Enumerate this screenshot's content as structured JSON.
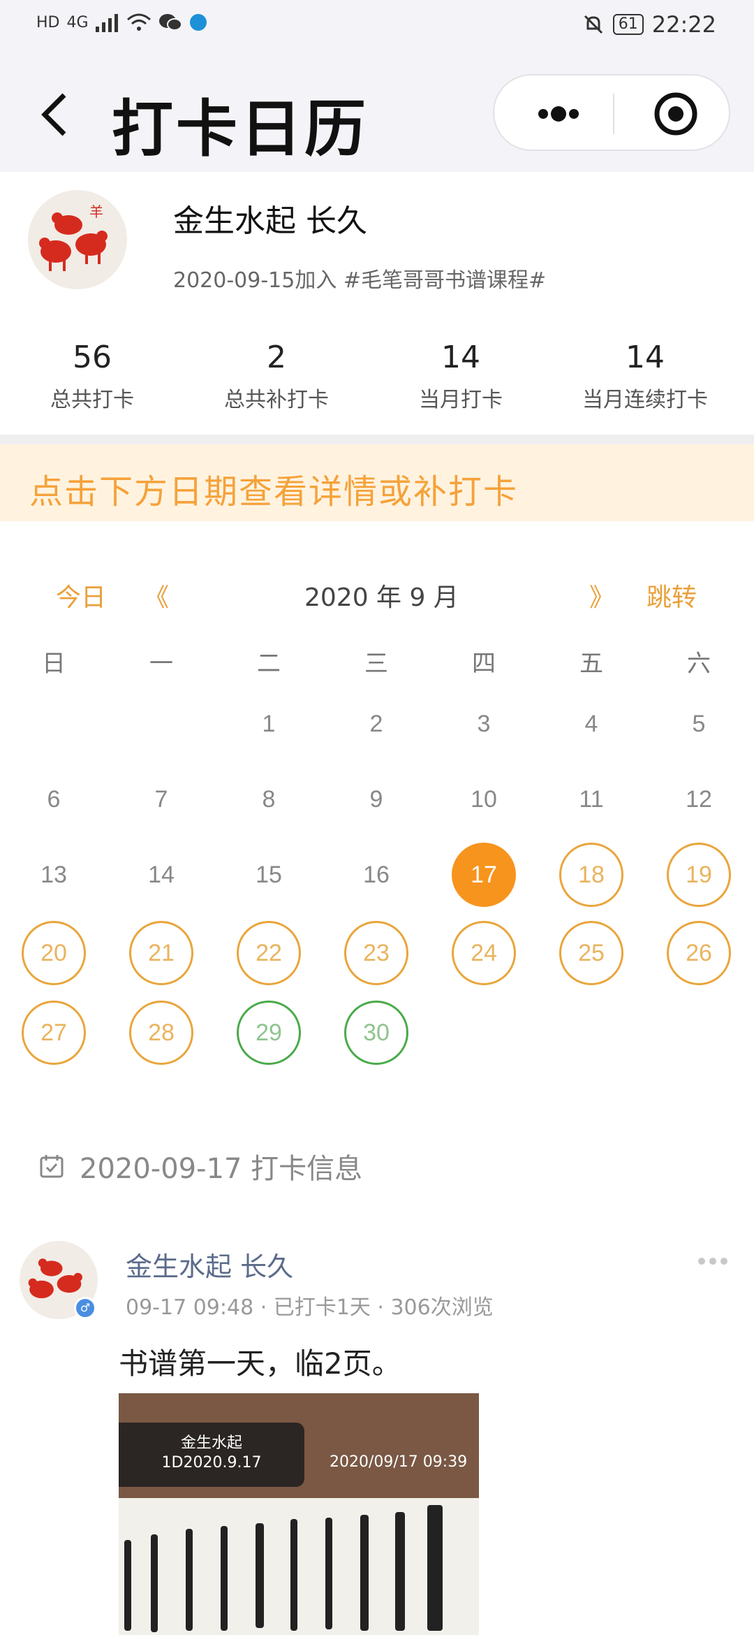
{
  "status_bar": {
    "left_indicators": [
      "HD",
      "4G"
    ],
    "battery": "61",
    "time": "22:22"
  },
  "header": {
    "title": "打卡日历",
    "icons": [
      "back-arrow-icon",
      "more-dots-icon",
      "target-circle-icon"
    ]
  },
  "profile": {
    "name": "金生水起 长久",
    "joined": "2020-09-15加入 #毛笔哥哥书谱课程#",
    "stats": [
      {
        "value": "56",
        "label": "总共打卡"
      },
      {
        "value": "2",
        "label": "总共补打卡"
      },
      {
        "value": "14",
        "label": "当月打卡"
      },
      {
        "value": "14",
        "label": "当月连续打卡"
      }
    ]
  },
  "notice": "点击下方日期查看详情或补打卡",
  "calendar": {
    "today": "今日",
    "prev": "《",
    "month_label": "2020 年 9 月",
    "next": "》",
    "jump": "跳转",
    "weekdays": [
      "日",
      "一",
      "二",
      "三",
      "四",
      "五",
      "六"
    ],
    "first_weekday_index": 2,
    "days_in_month": 30,
    "selected_day": 17,
    "checked_days": [
      18,
      19,
      20,
      21,
      22,
      23,
      24,
      25,
      26,
      27,
      28
    ],
    "makeup_days": [
      29,
      30
    ],
    "colors": {
      "checked": "#e9a53b",
      "makeup": "#4aaa4a",
      "selected": "#f7941d",
      "accent": "#e9a03a"
    }
  },
  "checkin_info": {
    "title": "2020-09-17 打卡信息",
    "icon": "calendar-check-icon"
  },
  "post": {
    "author": "金生水起 长久",
    "meta": "09-17 09:48 · 已打卡1天 · 306次浏览",
    "text": "书谱第一天，临2页。",
    "image": {
      "tag_line1": "金生水起",
      "tag_line2": "1D2020.9.17",
      "timestamp": "2020/09/17 09:39"
    }
  }
}
